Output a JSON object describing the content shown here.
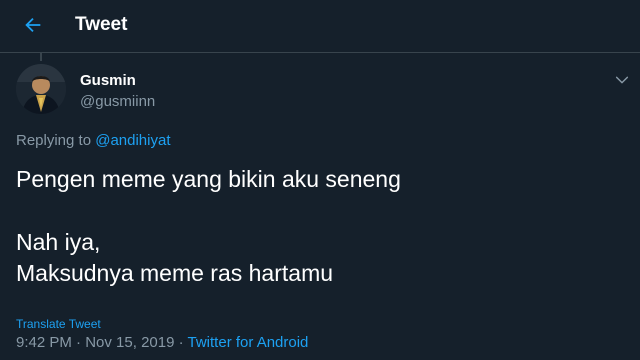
{
  "header": {
    "title": "Tweet"
  },
  "tweet": {
    "author": {
      "name": "Gusmin",
      "handle": "@gusmiinn"
    },
    "replying_prefix": "Replying to ",
    "replying_to": "@andihiyat",
    "lines": [
      "Pengen meme yang bikin aku seneng",
      "Nah iya,",
      "Maksudnya meme ras hartamu"
    ],
    "translate_label": "Translate Tweet",
    "time": "9:42 PM",
    "separator": " · ",
    "date": "Nov 15, 2019",
    "source": "Twitter for Android"
  },
  "colors": {
    "background": "#15202b",
    "accent": "#1da1f2",
    "secondary_text": "#8899a6",
    "border": "#38444d"
  },
  "icons": {
    "back": "back-arrow-icon",
    "caret": "chevron-down-icon"
  }
}
